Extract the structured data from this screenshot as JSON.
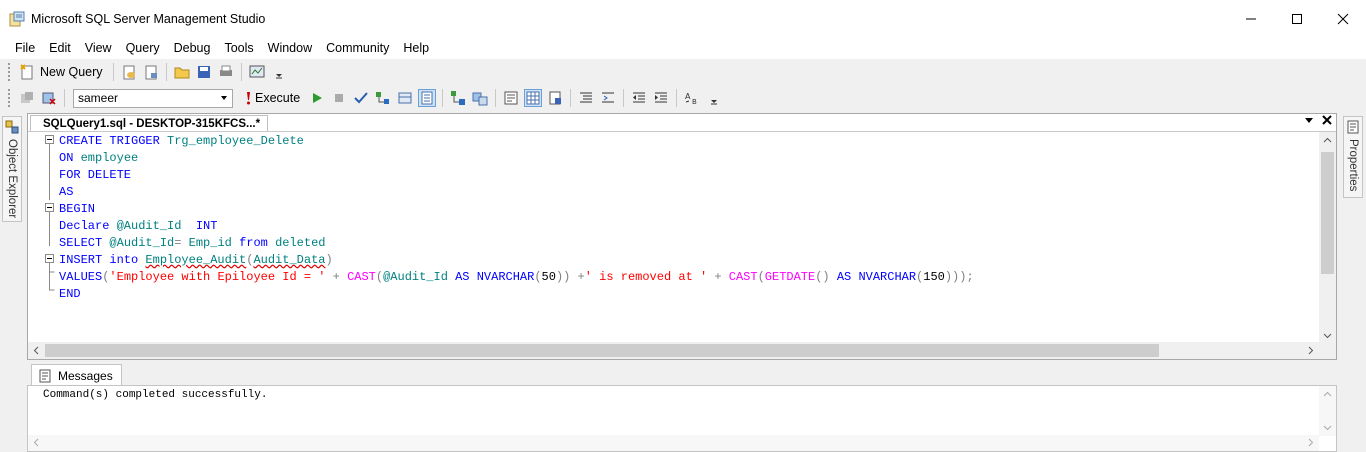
{
  "window": {
    "title": "Microsoft SQL Server Management Studio"
  },
  "menu": [
    "File",
    "Edit",
    "View",
    "Query",
    "Debug",
    "Tools",
    "Window",
    "Community",
    "Help"
  ],
  "toolbar1": {
    "new_query_label": "New Query"
  },
  "toolbar2": {
    "database": "sameer",
    "execute_label": "Execute"
  },
  "side": {
    "left_panel": "Object Explorer",
    "right_panel": "Properties"
  },
  "editor": {
    "tab_title": "SQLQuery1.sql - DESKTOP-315KFCS...*",
    "lines": [
      [
        {
          "t": "CREATE TRIGGER ",
          "c": "kw"
        },
        {
          "t": "Trg_employee_Delete",
          "c": "id"
        }
      ],
      [
        {
          "t": "ON ",
          "c": "kw"
        },
        {
          "t": "employee",
          "c": "id"
        }
      ],
      [
        {
          "t": "FOR DELETE",
          "c": "kw"
        }
      ],
      [
        {
          "t": "AS",
          "c": "kw"
        }
      ],
      [
        {
          "t": "BEGIN",
          "c": "kw"
        }
      ],
      [
        {
          "t": "Declare ",
          "c": "kw"
        },
        {
          "t": "@Audit_Id  ",
          "c": "id"
        },
        {
          "t": "INT",
          "c": "kw"
        }
      ],
      [
        {
          "t": "SELECT ",
          "c": "kw"
        },
        {
          "t": "@Audit_Id",
          "c": "id"
        },
        {
          "t": "= ",
          "c": "op"
        },
        {
          "t": "Emp_id ",
          "c": "id"
        },
        {
          "t": "from ",
          "c": "kw"
        },
        {
          "t": "deleted",
          "c": "id"
        }
      ],
      [
        {
          "t": "INSERT into ",
          "c": "kw"
        },
        {
          "t": "Employee_Audit",
          "c": "id"
        },
        {
          "t": "(",
          "c": "op"
        },
        {
          "t": "Audit_Data",
          "c": "id"
        },
        {
          "t": ")",
          "c": "op"
        }
      ],
      [
        {
          "t": "VALUES",
          "c": "kw"
        },
        {
          "t": "(",
          "c": "op"
        },
        {
          "t": "'Employee with Epiloyee Id = '",
          "c": "str"
        },
        {
          "t": " + ",
          "c": "op"
        },
        {
          "t": "CAST",
          "c": "fn"
        },
        {
          "t": "(",
          "c": "op"
        },
        {
          "t": "@Audit_Id ",
          "c": "id"
        },
        {
          "t": "AS ",
          "c": "kw"
        },
        {
          "t": "NVARCHAR",
          "c": "kw"
        },
        {
          "t": "(",
          "c": "op"
        },
        {
          "t": "50",
          "c": "txt"
        },
        {
          "t": ")) +",
          "c": "op"
        },
        {
          "t": "' is removed at '",
          "c": "str"
        },
        {
          "t": " + ",
          "c": "op"
        },
        {
          "t": "CAST",
          "c": "fn"
        },
        {
          "t": "(",
          "c": "op"
        },
        {
          "t": "GETDATE",
          "c": "fn"
        },
        {
          "t": "() ",
          "c": "op"
        },
        {
          "t": "AS ",
          "c": "kw"
        },
        {
          "t": "NVARCHAR",
          "c": "kw"
        },
        {
          "t": "(",
          "c": "op"
        },
        {
          "t": "150",
          "c": "txt"
        },
        {
          "t": ")));",
          "c": "op"
        }
      ],
      [
        {
          "t": "END",
          "c": "kw"
        }
      ]
    ]
  },
  "results": {
    "tab_label": "Messages",
    "message": "Command(s) completed successfully."
  }
}
